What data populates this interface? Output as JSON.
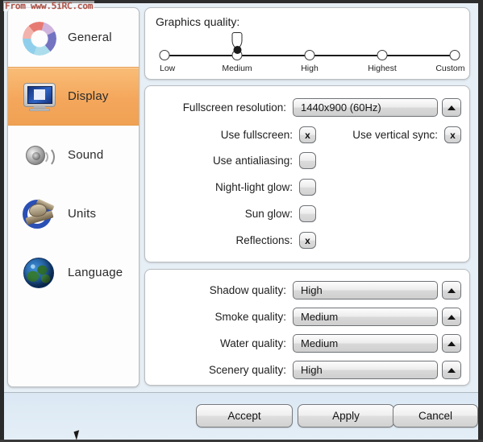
{
  "watermark": "From www.5iRC.com",
  "sidebar": {
    "items": [
      {
        "label": "General",
        "icon": "general-wheel-icon",
        "selected": false
      },
      {
        "label": "Display",
        "icon": "monitor-icon",
        "selected": true
      },
      {
        "label": "Sound",
        "icon": "speaker-icon",
        "selected": false
      },
      {
        "label": "Units",
        "icon": "sextant-icon",
        "selected": false
      },
      {
        "label": "Language",
        "icon": "globe-icon",
        "selected": false
      }
    ],
    "selected_color": "#f3a557"
  },
  "quality_group": {
    "title": "Graphics quality:",
    "ticks": [
      "Low",
      "Medium",
      "High",
      "Highest",
      "Custom"
    ],
    "value": "Medium",
    "value_index": 1
  },
  "display_group": {
    "resolution": {
      "label": "Fullscreen resolution:",
      "value": "1440x900 (60Hz)",
      "arrow_icon": "triangle-up-icon"
    },
    "checks": [
      {
        "label": "Use fullscreen:",
        "checked": true,
        "mark": "x"
      },
      {
        "label": "Use vertical sync:",
        "checked": true,
        "mark": "x"
      },
      {
        "label": "Use antialiasing:",
        "checked": false,
        "mark": ""
      },
      {
        "label": "Night-light glow:",
        "checked": false,
        "mark": ""
      },
      {
        "label": "Sun glow:",
        "checked": false,
        "mark": ""
      },
      {
        "label": "Reflections:",
        "checked": true,
        "mark": "x"
      }
    ]
  },
  "detail_group": {
    "rows": [
      {
        "label": "Shadow quality:",
        "value": "High"
      },
      {
        "label": "Smoke quality:",
        "value": "Medium"
      },
      {
        "label": "Water quality:",
        "value": "Medium"
      },
      {
        "label": "Scenery quality:",
        "value": "High"
      }
    ],
    "arrow_icon": "triangle-up-icon"
  },
  "footer": {
    "accept": "Accept",
    "apply": "Apply",
    "cancel": "Cancel"
  }
}
